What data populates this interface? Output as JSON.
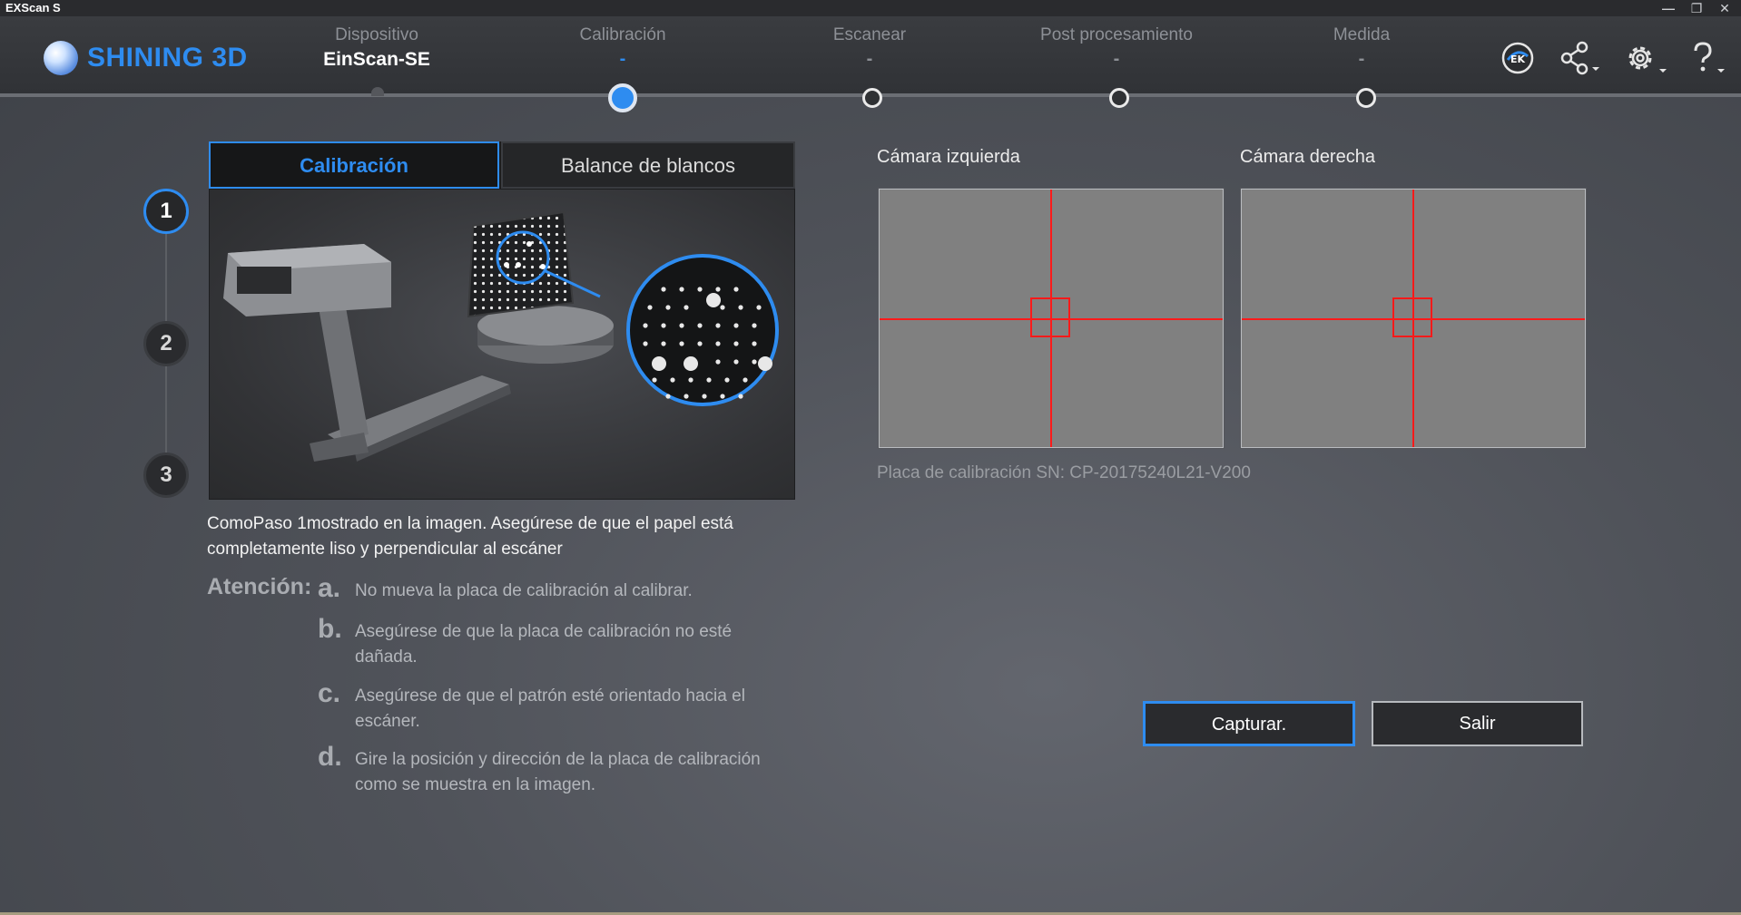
{
  "window": {
    "title": "EXScan S"
  },
  "brand": {
    "name": "SHINING 3D",
    "accent": "#2e8cf0"
  },
  "steps": [
    {
      "label": "Dispositivo",
      "sub": "EinScan-SE"
    },
    {
      "label": "Calibración",
      "sub": "-"
    },
    {
      "label": "Escanear",
      "sub": "-"
    },
    {
      "label": "Post procesamiento",
      "sub": "-"
    },
    {
      "label": "Medida",
      "sub": "-"
    }
  ],
  "toolbar": {
    "icons": [
      "ek-model-icon",
      "share-icon",
      "settings-icon",
      "help-icon"
    ],
    "ek_text": "EK"
  },
  "wizard": {
    "numbers": [
      "1",
      "2",
      "3"
    ],
    "active": 1
  },
  "tabs": {
    "calibration": "Calibración",
    "white_balance": "Balance de blancos"
  },
  "instructions": {
    "description": "ComoPaso 1mostrado en la imagen. Asegúrese de que el papel está completamente liso y perpendicular al escáner",
    "attention_label": "Atención:",
    "items": [
      {
        "letter": "a.",
        "text": "No mueva la placa de calibración al calibrar."
      },
      {
        "letter": "b.",
        "text": "Asegúrese de que la placa de calibración no esté dañada."
      },
      {
        "letter": "c.",
        "text": "Asegúrese de que el patrón esté orientado hacia el escáner."
      },
      {
        "letter": "d.",
        "text": "Gire la posición y dirección de la placa de calibración como se muestra en la imagen."
      }
    ]
  },
  "cameras": {
    "left_label": "Cámara izquierda",
    "right_label": "Cámara derecha"
  },
  "serial": "Placa de calibración SN: CP-20175240L21-V200",
  "buttons": {
    "capture": "Capturar.",
    "exit": "Salir"
  }
}
